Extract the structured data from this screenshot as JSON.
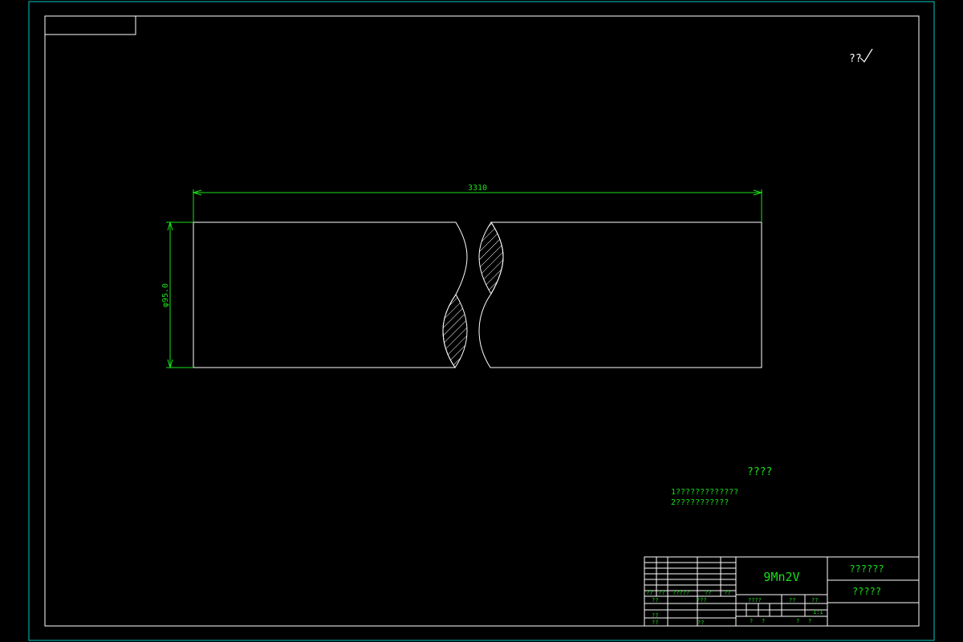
{
  "colors": {
    "background": "#000000",
    "frame": "#00c8c8",
    "part": "#ffffff",
    "text": "#18e018",
    "dimension": "#18e018"
  },
  "roughness_symbol": "??",
  "dimensions": {
    "length": "3310",
    "diameter": "φ95.0"
  },
  "notes": {
    "heading": "????",
    "line1": "1?????????????",
    "line2": "2???????????"
  },
  "title_block": {
    "material": "9Mn2V",
    "drawing_name": "??????",
    "drawing_number": "?????",
    "row_labels": [
      "??",
      "??",
      "?????",
      "??",
      "??"
    ],
    "left_labels": [
      "??",
      "??",
      "??",
      "??"
    ],
    "mid_labels": [
      "???",
      "??"
    ],
    "stage_label": "????",
    "weight_label": "??",
    "scale_label": "??",
    "scale_value": "1:1",
    "sheet_labels": [
      "?",
      "?",
      "?",
      "?"
    ]
  }
}
